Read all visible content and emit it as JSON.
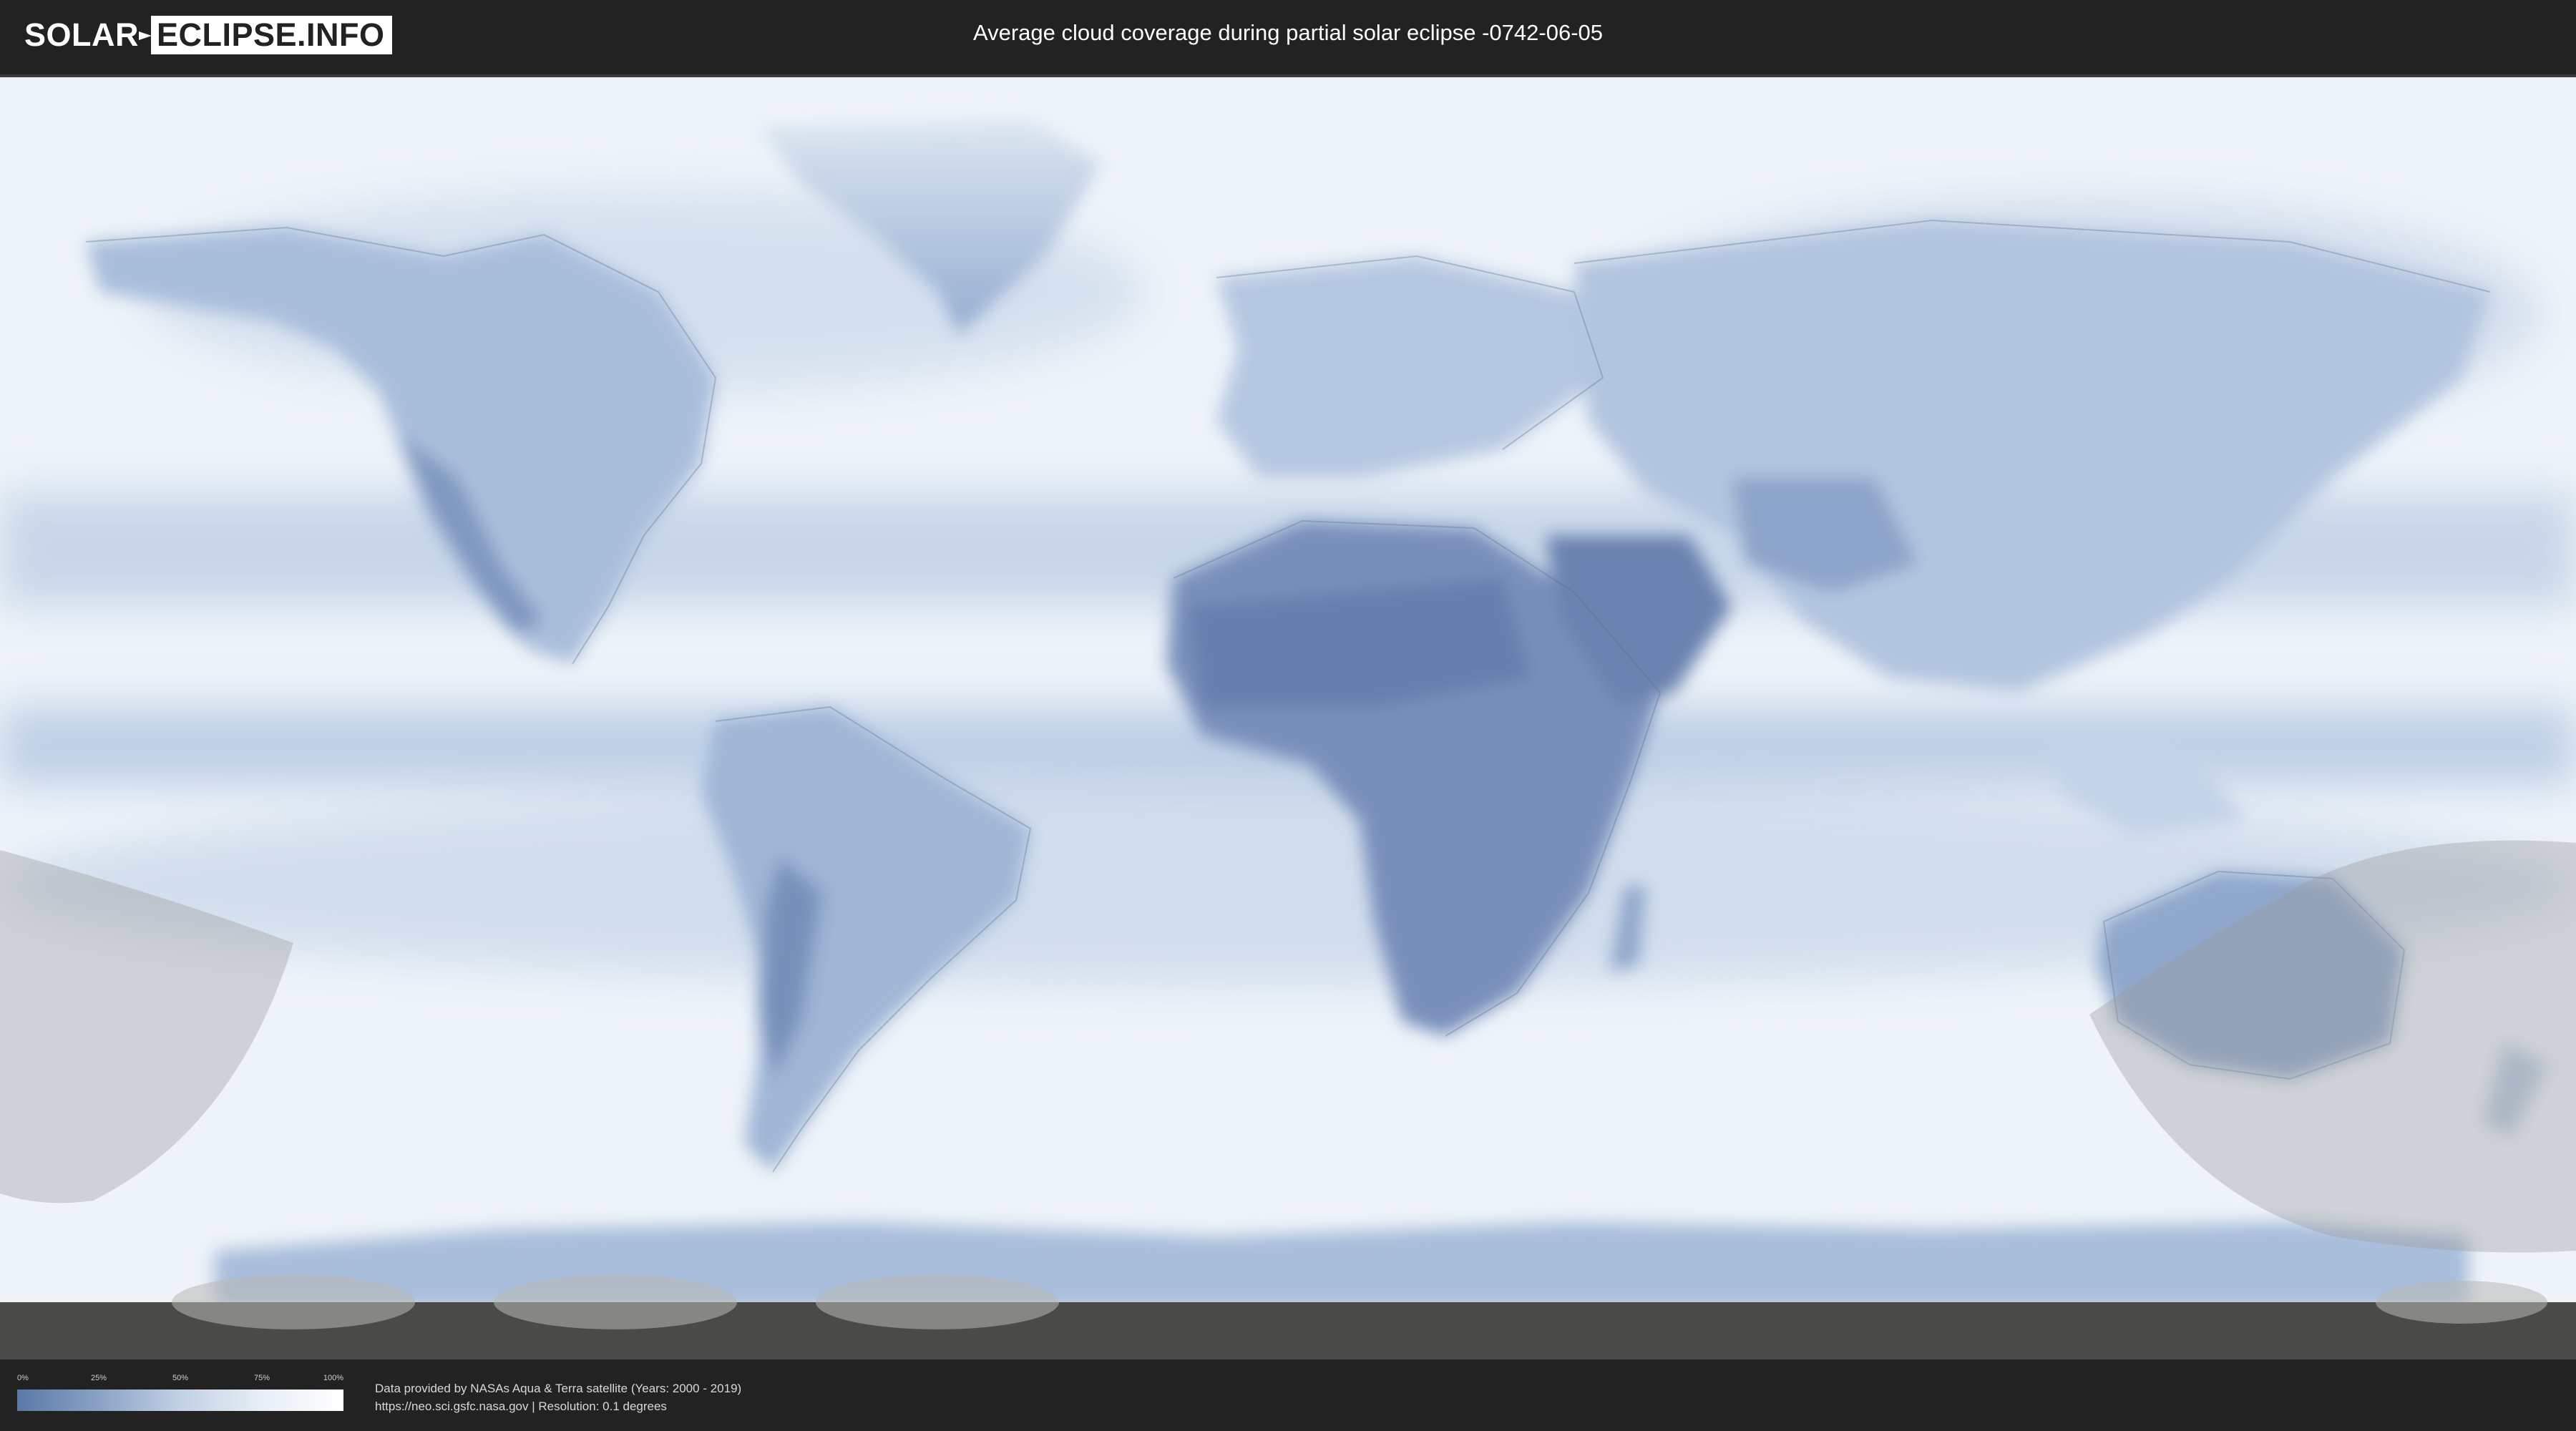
{
  "header": {
    "logo_left": "SOLAR",
    "logo_right": "ECLIPSE.INFO",
    "title": "Average cloud coverage during partial solar eclipse -0742-06-05"
  },
  "map": {
    "colors": {
      "ocean_cloud": "#e9f0f7",
      "clear_sky": "#5b79a7",
      "mid_cover": "#a8bedb",
      "borders": "#5d6f87",
      "eclipse_overlay": "#9a9a9a",
      "night_band": "#4a4a48"
    }
  },
  "legend": {
    "ticks": [
      "0%",
      "25%",
      "50%",
      "75%",
      "100%"
    ],
    "tick_values": [
      0,
      25,
      50,
      75,
      100
    ]
  },
  "footer": {
    "line1": "Data provided by NASAs Aqua & Terra satellite (Years: 2000 - 2019)",
    "line2": "https://neo.sci.gsfc.nasa.gov | Resolution: 0.1 degrees"
  }
}
